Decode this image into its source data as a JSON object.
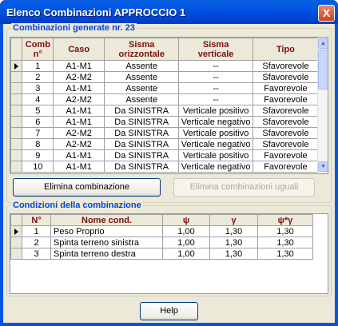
{
  "window": {
    "title": "Elenco Combinazioni APPROCCIO 1",
    "close_label": "X"
  },
  "top_group": {
    "title": "Combinazioni generate nr. 23",
    "headers": {
      "comb_line1": "Comb",
      "comb_line2": "n°",
      "caso": "Caso",
      "sisma_orizz_line1": "Sisma",
      "sisma_orizz_line2": "orizzontale",
      "sisma_vert_line1": "Sisma",
      "sisma_vert_line2": "verticale",
      "tipo": "Tipo"
    },
    "rows": [
      {
        "n": "1",
        "caso": "A1-M1",
        "orizz": "Assente",
        "vert": "--",
        "tipo": "Sfavorevole"
      },
      {
        "n": "2",
        "caso": "A2-M2",
        "orizz": "Assente",
        "vert": "--",
        "tipo": "Sfavorevole"
      },
      {
        "n": "3",
        "caso": "A1-M1",
        "orizz": "Assente",
        "vert": "--",
        "tipo": "Favorevole"
      },
      {
        "n": "4",
        "caso": "A2-M2",
        "orizz": "Assente",
        "vert": "--",
        "tipo": "Favorevole"
      },
      {
        "n": "5",
        "caso": "A1-M1",
        "orizz": "Da SINISTRA",
        "vert": "Verticale positivo",
        "tipo": "Sfavorevole"
      },
      {
        "n": "6",
        "caso": "A1-M1",
        "orizz": "Da SINISTRA",
        "vert": "Verticale negativo",
        "tipo": "Sfavorevole"
      },
      {
        "n": "7",
        "caso": "A2-M2",
        "orizz": "Da SINISTRA",
        "vert": "Verticale positivo",
        "tipo": "Sfavorevole"
      },
      {
        "n": "8",
        "caso": "A2-M2",
        "orizz": "Da SINISTRA",
        "vert": "Verticale negativo",
        "tipo": "Sfavorevole"
      },
      {
        "n": "9",
        "caso": "A1-M1",
        "orizz": "Da SINISTRA",
        "vert": "Verticale positivo",
        "tipo": "Favorevole"
      },
      {
        "n": "10",
        "caso": "A1-M1",
        "orizz": "Da SINISTRA",
        "vert": "Verticale negativo",
        "tipo": "Favorevole"
      }
    ],
    "delete_button": "Elimina combinazione",
    "delete_equal_button": "Elimina combinazioni uguali"
  },
  "bottom_group": {
    "title": "Condizioni della combinazione",
    "headers": {
      "n": "N°",
      "nome": "Nome cond.",
      "psi": "ψ",
      "gamma": "γ",
      "psi_gamma": "ψ*γ"
    },
    "rows": [
      {
        "n": "1",
        "nome": "Peso Proprio",
        "psi": "1,00",
        "gamma": "1,30",
        "psi_gamma": "1,30"
      },
      {
        "n": "2",
        "nome": "Spinta terreno sinistra",
        "psi": "1,00",
        "gamma": "1,30",
        "psi_gamma": "1,30"
      },
      {
        "n": "3",
        "nome": "Spinta terreno destra",
        "psi": "1,00",
        "gamma": "1,30",
        "psi_gamma": "1,30"
      }
    ]
  },
  "help_button": "Help"
}
